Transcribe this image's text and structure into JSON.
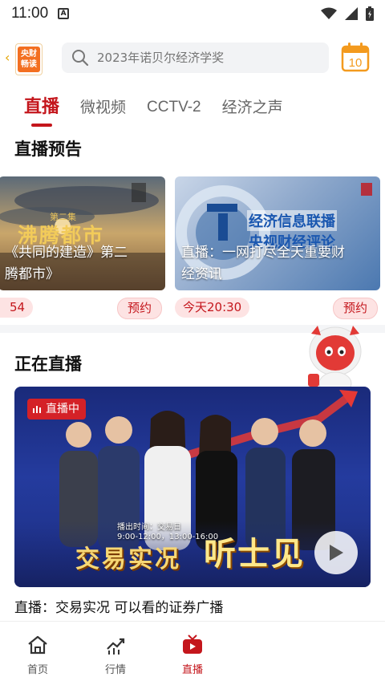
{
  "status_bar": {
    "time": "11:00",
    "notification_letter": "A"
  },
  "header": {
    "logo_text_line1": "央财",
    "logo_text_line2": "畅读",
    "search_placeholder": "2023年诺贝尔经济学奖",
    "calendar_day": "10"
  },
  "tabs": [
    {
      "label": "直播",
      "active": true
    },
    {
      "label": "微视频",
      "active": false
    },
    {
      "label": "CCTV-2",
      "active": false
    },
    {
      "label": "经济之声",
      "active": false
    }
  ],
  "preview_section": {
    "title": "直播预告",
    "cards": [
      {
        "art_title": "沸腾都市",
        "art_subtitle": "第二集",
        "caption": "《共同的建造》第二腾都市》",
        "caption_line1": "《共同的建造》第二",
        "caption_line2": "腾都市》",
        "time": "54",
        "button": "预约"
      },
      {
        "art_title": "经济信息联播",
        "art_subtitle": "央视财经评论",
        "caption_line1": "直播：一网打尽全天重要财",
        "caption_line2": "经资讯",
        "time": "今天20:30",
        "button": "预约"
      }
    ]
  },
  "live_section": {
    "title": "正在直播",
    "badge": "直播中",
    "banner_main": "交易实况",
    "banner_accent": "听士见",
    "banner_schedule_line1": "播出时间：交易日",
    "banner_schedule_line2": "9:00-12:00，13:00-16:00",
    "item_title": "直播：交易实况 可以看的证券广播"
  },
  "bottom_nav": [
    {
      "label": "首页",
      "icon": "home-icon",
      "active": false
    },
    {
      "label": "行情",
      "icon": "chart-icon",
      "active": false
    },
    {
      "label": "直播",
      "icon": "tv-icon",
      "active": true
    }
  ],
  "colors": {
    "accent": "#c4161c",
    "pill_bg": "#fde3e3"
  }
}
